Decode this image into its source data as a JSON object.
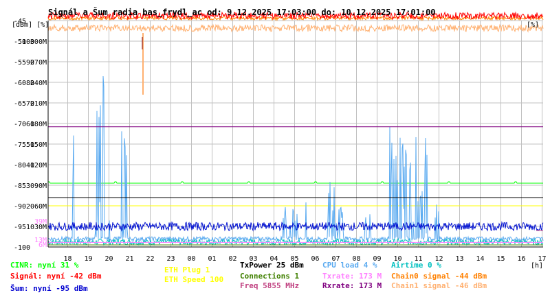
{
  "chart_data": {
    "type": "line",
    "title": "Signál a Šum radia bas_frydl_ac od: 9.12.2025 17:03:00 do: 10.12.2025 17:01:00",
    "axis_units_left": "[dBm] [%]",
    "axis_units_right": "[%]",
    "xlabel_unit": "[h]",
    "x_ticks": [
      "18",
      "19",
      "20",
      "21",
      "22",
      "23",
      "00",
      "01",
      "02",
      "03",
      "04",
      "05",
      "06",
      "07",
      "08",
      "09",
      "10",
      "11",
      "12",
      "13",
      "14",
      "15",
      "16",
      "17"
    ],
    "y_dbm_ticks": [
      "-45",
      "-50",
      "-55",
      "-60",
      "-65",
      "-70",
      "-75",
      "-80",
      "-85",
      "-90",
      "-95",
      "-100"
    ],
    "y_pct_ticks": [
      "100",
      "90",
      "80",
      "70",
      "60",
      "50",
      "40",
      "30",
      "20",
      "10"
    ],
    "y_rate_ticks": [
      "300M",
      "270M",
      "240M",
      "210M",
      "180M",
      "150M",
      "120M",
      "90M",
      "60M",
      "30M"
    ],
    "y_rate_overlay_ticks": [
      "39M",
      "13M",
      "6M"
    ],
    "ylim_dbm": [
      -100,
      -45
    ],
    "ylim_pct": [
      0,
      100
    ],
    "grid": true,
    "series": [
      {
        "name": "Airtime",
        "color": "#00c0c0",
        "kind": "noise",
        "base_pct": 2.5,
        "spread_pct": 1.5
      },
      {
        "name": "CPU load",
        "color": "#5aaaf0",
        "kind": "spikes",
        "base_pct": 3,
        "spread_pct": 2,
        "bursts": [
          {
            "x": [
              18.2,
              18.3
            ],
            "peak_pct": 62
          },
          {
            "x": [
              19.3,
              19.8
            ],
            "peak_pct": 84
          },
          {
            "x": [
              20.0,
              20.2
            ],
            "peak_pct": 58
          },
          {
            "x": [
              20.6,
              20.9
            ],
            "peak_pct": 60
          },
          {
            "x": [
              4.4,
              5.6
            ],
            "peak_pct": 22
          },
          {
            "x": [
              6.6,
              7.4
            ],
            "peak_pct": 32
          },
          {
            "x": [
              8.4,
              8.8
            ],
            "peak_pct": 20
          },
          {
            "x": [
              9.6,
              11.5
            ],
            "peak_pct": 61
          },
          {
            "x": [
              11.8,
              12.0
            ],
            "peak_pct": 22
          }
        ]
      },
      {
        "name": "Šum",
        "color": "#0010d0",
        "kind": "noise",
        "base_dbm": -95,
        "spread_db": 1
      },
      {
        "name": "Signál",
        "color": "#ff0000",
        "kind": "noise",
        "base_dbm": -42,
        "spread_db": 1
      },
      {
        "name": "Chain0 signal",
        "color": "#ff8000",
        "kind": "noise",
        "base_dbm": -44,
        "spread_db": 1
      },
      {
        "name": "Chain1 signal",
        "color": "#ffb070",
        "kind": "noise",
        "base_dbm": -46,
        "spread_db": 1
      },
      {
        "name": "Txrate",
        "color": "#ff80ff",
        "kind": "flat",
        "value_mbps": 173
      },
      {
        "name": "Rxrate",
        "color": "#800080",
        "kind": "flat",
        "value_mbps": 173
      },
      {
        "name": "ETH Speed",
        "color": "#ffff00",
        "kind": "flat",
        "value_pct": 20
      },
      {
        "name": "CINR",
        "color": "#00ff00",
        "kind": "flat",
        "value_pct": 31
      },
      {
        "name": "Connections",
        "color": "#408000",
        "kind": "flat",
        "value_pct": 1
      },
      {
        "name": "TxPower",
        "color": "#000000",
        "kind": "flat",
        "value_dbm": -88
      },
      {
        "name": "Freq",
        "color": "#c04080",
        "kind": "flat",
        "value_mhz": 5855
      }
    ]
  },
  "legend": {
    "cinr": "CINR: nyní 31 %",
    "signal": "Signál: nyní -42 dBm",
    "noise": "Šum: nyní -95 dBm",
    "eth_plug": "ETH Plug 1",
    "eth_speed": "ETH Speed 100",
    "txpower": "TxPower 25 dBm",
    "connections": "Connections 1",
    "freq": "Freq 5855 MHz",
    "cpu": "CPU load 4 %",
    "txrate": "Txrate: 173 M",
    "rxrate": "Rxrate: 173 M",
    "airtime": "Airtime 0 %",
    "chain0": "Chain0 signal -44 dBm",
    "chain1": "Chain1 signal -46 dBm"
  },
  "colors": {
    "cinr": "#00ff00",
    "signal": "#ff0000",
    "noise": "#0000d0",
    "eth_plug": "#ffff00",
    "eth_speed": "#ffff00",
    "txpower": "#000000",
    "connections": "#408000",
    "freq": "#c04080",
    "cpu": "#5aaaf0",
    "txrate": "#ff80ff",
    "rxrate": "#800080",
    "airtime": "#00c0c0",
    "chain0": "#ff8000",
    "chain1": "#ffb070"
  }
}
